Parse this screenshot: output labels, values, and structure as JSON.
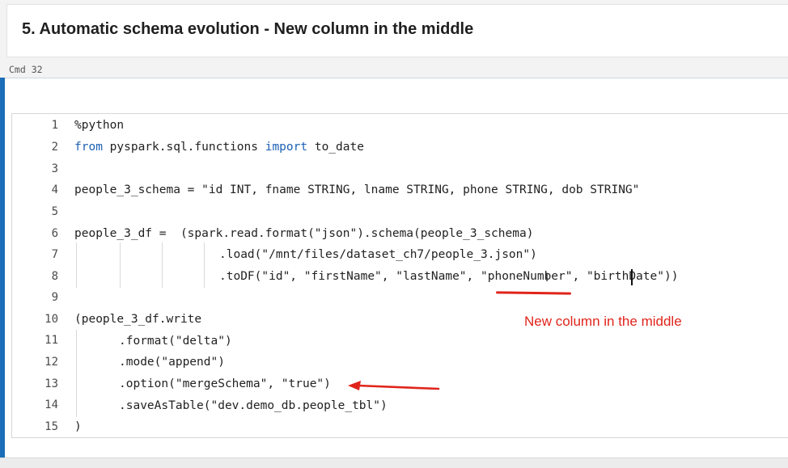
{
  "markdown_cell": {
    "title": "5. Automatic schema evolution - New column in the middle"
  },
  "cmd_label": "Cmd 32",
  "editor": {
    "line_numbers": [
      "1",
      "2",
      "3",
      "4",
      "5",
      "6",
      "7",
      "8",
      "9",
      "10",
      "11",
      "12",
      "13",
      "14",
      "15"
    ],
    "lines": {
      "l1": "%python",
      "l2_kw1": "from",
      "l2_mod": " pyspark.sql.functions ",
      "l2_kw2": "import",
      "l2_fn": " to_date",
      "l4": "people_3_schema = \"id INT, fname STRING, lname STRING, phone STRING, dob STRING\"",
      "l6": "people_3_df =  (spark.read.format(\"json\").schema(people_3_schema)",
      "l7": ".load(\"/mnt/files/dataset_ch7/people_3.json\")",
      "l8": ".toDF(\"id\", \"firstName\", \"lastName\", \"phoneNumber\", \"birthDate\"))",
      "l10": "(people_3_df.write",
      "l11": ".format(\"delta\")",
      "l12": ".mode(\"append\")",
      "l13": ".option(\"mergeSchema\", \"true\")",
      "l14": ".saveAsTable(\"dev.demo_db.people_tbl\")",
      "l15": ")"
    }
  },
  "annotation": {
    "text": "New column in the middle",
    "color": "#e0241b"
  },
  "colors": {
    "accent": "#1b6eb7",
    "keyword": "#1a5fb4"
  }
}
